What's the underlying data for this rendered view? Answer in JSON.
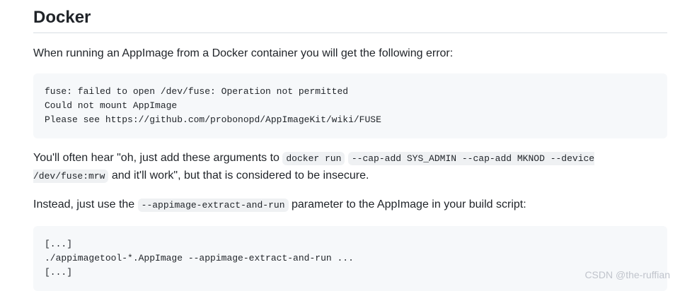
{
  "heading": "Docker",
  "intro": "When running an AppImage from a Docker container you will get the following error:",
  "error_block": {
    "lines": [
      "fuse: failed to open /dev/fuse: Operation not permitted",
      "Could not mount AppImage",
      "Please see https://github.com/probonopd/AppImageKit/wiki/FUSE"
    ]
  },
  "para2": {
    "text_before": "You'll often hear \"oh, just add these arguments to ",
    "code1": "docker run",
    "between": " ",
    "code2": "--cap-add SYS_ADMIN --cap-add MKNOD --device /dev/fuse:mrw",
    "text_after": " and it'll work\", but that is considered to be insecure."
  },
  "para3": {
    "text_before": "Instead, just use the ",
    "code": "--appimage-extract-and-run",
    "text_after": " parameter to the AppImage in your build script:"
  },
  "script_block": {
    "lines": [
      "[...]",
      "./appimagetool-*.AppImage --appimage-extract-and-run ...",
      "[...]"
    ]
  },
  "watermark": "CSDN @the-ruffian"
}
